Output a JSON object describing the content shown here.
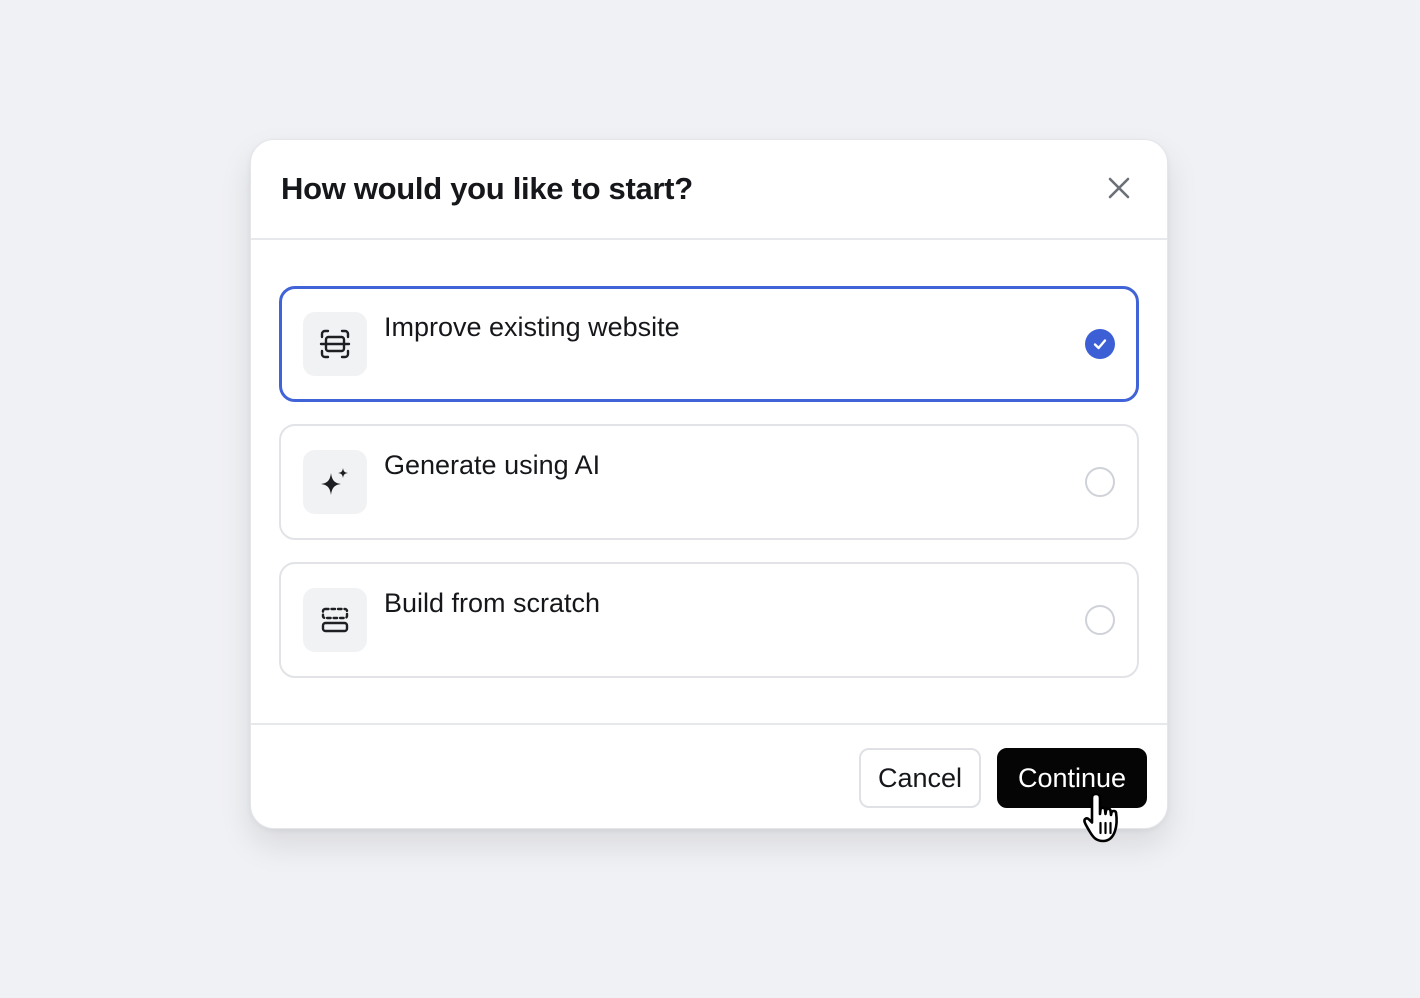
{
  "dialog": {
    "title": "How would you like to start?",
    "close_icon": "close-icon",
    "options": [
      {
        "label": "Improve existing website",
        "icon": "scan-frame-icon",
        "selected": true
      },
      {
        "label": "Generate using AI",
        "icon": "sparkles-icon",
        "selected": false
      },
      {
        "label": "Build from scratch",
        "icon": "layout-blocks-icon",
        "selected": false
      }
    ],
    "footer": {
      "cancel_label": "Cancel",
      "continue_label": "Continue"
    }
  },
  "colors": {
    "background": "#f0f1f4",
    "accent": "#3d5fd6",
    "primary_button": "#050505",
    "border": "#e1e3e7"
  }
}
